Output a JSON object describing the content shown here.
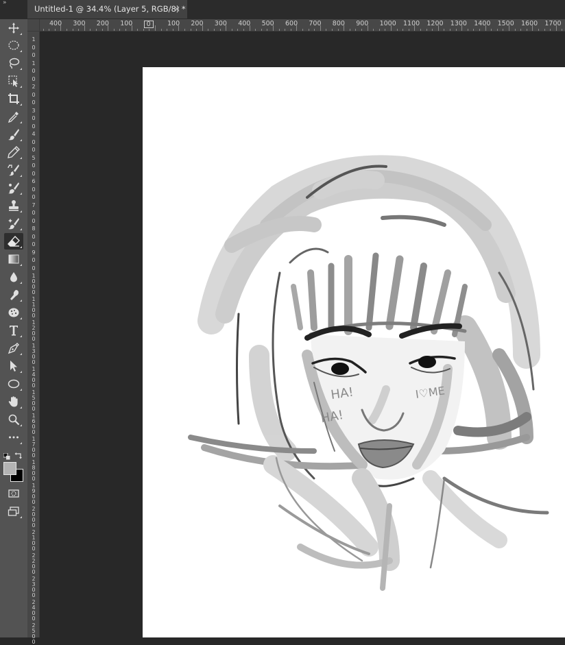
{
  "document_tab": {
    "title": "Untitled-1 @ 34.4% (Layer 5, RGB/8) *",
    "close_symbol": "×"
  },
  "collapse_symbol": "»",
  "toolbar": {
    "active_tool": "eraser-tool",
    "tools": [
      "move-tool",
      "marquee-tool",
      "lasso-tool",
      "object-selection-tool",
      "crop-tool",
      "eyedropper-tool",
      "brush-tool",
      "pencil-tool",
      "mixer-brush-tool",
      "history-brush-tool",
      "clone-stamp-tool",
      "healing-brush-tool",
      "eraser-tool",
      "gradient-tool",
      "blur-tool",
      "smudge-tool",
      "sponge-tool",
      "type-tool",
      "pen-tool",
      "path-selection-tool",
      "ellipse-tool",
      "hand-tool",
      "zoom-tool",
      "more-tools"
    ],
    "foreground_color": "#b3b3b3",
    "background_color": "#000000"
  },
  "rulers": {
    "horizontal_labels": [
      "400",
      "300",
      "200",
      "100",
      "0",
      "100",
      "200",
      "300",
      "400",
      "500",
      "600",
      "700",
      "800",
      "900",
      "1000",
      "1100",
      "1200",
      "1300",
      "1400",
      "1500",
      "1600",
      "1700"
    ],
    "vertical_labels": [
      "1",
      "0",
      "0",
      "1",
      "0",
      "0",
      "2",
      "0",
      "0",
      "3",
      "0",
      "0",
      "4",
      "0",
      "0",
      "5",
      "0",
      "0",
      "6",
      "0",
      "0",
      "7",
      "0",
      "0",
      "8",
      "0",
      "0",
      "9",
      "0",
      "0",
      "1\n0\n0\n0",
      "1\n1\n0\n0",
      "1\n2\n0\n0",
      "1\n3\n0\n0",
      "1\n4\n0\n0",
      "1\n5\n0\n0",
      "1\n6\n0\n0",
      "1\n7\n0\n0",
      "1\n8\n0\n0",
      "1\n9\n0\n0",
      "2\n0\n0\n0",
      "2\n1\n0\n0",
      "2\n2\n0\n0",
      "2\n3\n0\n0",
      "2\n4\n0\n0",
      "2\n5\n0\n0"
    ]
  },
  "artwork": {
    "face_text_1": "HA!",
    "face_text_2": "HA!",
    "face_text_3": "I♡ME"
  },
  "colors": {
    "app_background": "#282828",
    "toolbar": "#535353",
    "ruler": "#474747",
    "tab": "#424242",
    "canvas": "#ffffff"
  }
}
